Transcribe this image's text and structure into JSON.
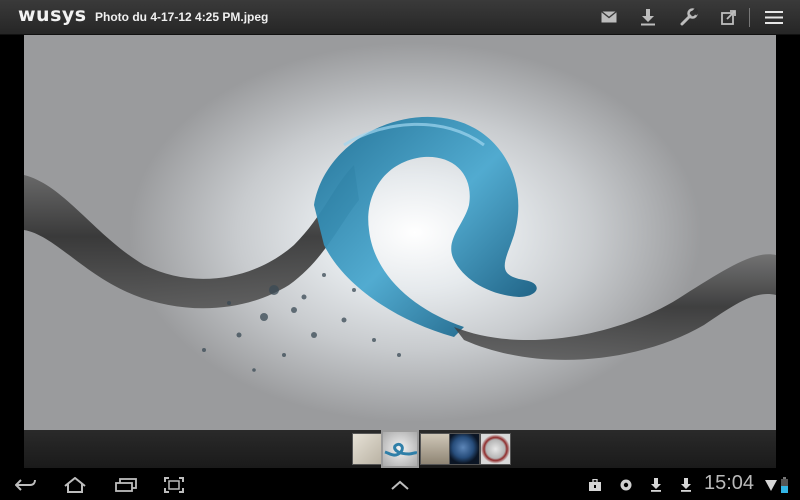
{
  "app": {
    "logo": "wusys"
  },
  "header": {
    "title": "Photo du 4-17-12 4:25 PM.jpeg",
    "actions": [
      "mail-icon",
      "download-icon",
      "wrench-icon",
      "share-icon",
      "menu-icon"
    ]
  },
  "filmstrip": {
    "thumbnails": [
      "thumb-sketch",
      "thumb-water-wave",
      "thumb-room",
      "thumb-earth",
      "thumb-clock"
    ],
    "selected_index": 1
  },
  "system_bar": {
    "nav": [
      "back-icon",
      "home-icon",
      "recent-apps-icon",
      "screenshot-icon"
    ],
    "center": "chevron-up-icon",
    "notifications": [
      "briefcase-icon",
      "settings-notify-icon",
      "download-notify-icon",
      "download-notify-icon"
    ],
    "clock": "15:04",
    "status": [
      "wifi-icon",
      "battery-icon"
    ]
  },
  "colors": {
    "bar": "#2e2e2e",
    "icon": "#cfcfcf",
    "battery": "#33b5e5"
  }
}
